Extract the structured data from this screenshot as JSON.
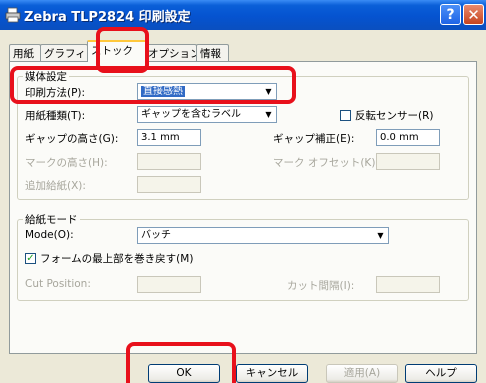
{
  "window": {
    "title": "Zebra TLP2824 印刷設定",
    "help_label": "?",
    "close_label": "✕",
    "icon": "printer-icon"
  },
  "tabs": [
    {
      "label": "用紙",
      "active": false
    },
    {
      "label": "グラフィック",
      "active": false
    },
    {
      "label": "ストック",
      "active": true
    },
    {
      "label": "オプション",
      "active": false
    },
    {
      "label": "情報",
      "active": false
    }
  ],
  "media_group": {
    "title": "媒体設定",
    "print_method_label": "印刷方法(P):",
    "print_method_value": "直接感熱",
    "media_type_label": "用紙種類(T):",
    "media_type_value": "ギャップを含むラベル",
    "reverse_sensor_label": "反転センサー(R)",
    "reverse_sensor_checked": false,
    "gap_height_label": "ギャップの高さ(G):",
    "gap_height_value": "3.1 mm",
    "gap_offset_label": "ギャップ補正(E):",
    "gap_offset_value": "0.0 mm",
    "mark_height_label": "マークの高さ(H):",
    "mark_height_value": "",
    "mark_offset_label": "マーク オフセット(K):",
    "mark_offset_value": "",
    "extra_feed_label": "追加給紙(X):",
    "extra_feed_value": ""
  },
  "feed_group": {
    "title": "給紙モード",
    "mode_label": "Mode(O):",
    "mode_value": "バッチ",
    "rewind_label": "フォームの最上部を巻き戻す(M)",
    "rewind_checked": true,
    "cut_position_label": "Cut Position:",
    "cut_position_value": "",
    "cut_interval_label": "カット間隔(I):",
    "cut_interval_value": ""
  },
  "buttons": {
    "ok": "OK",
    "cancel": "キャンセル",
    "apply": "適用(A)",
    "help": "ヘルプ"
  },
  "colors": {
    "highlight": "#e8101b",
    "titlebar": "#0553d0",
    "selection": "#316ac5"
  }
}
